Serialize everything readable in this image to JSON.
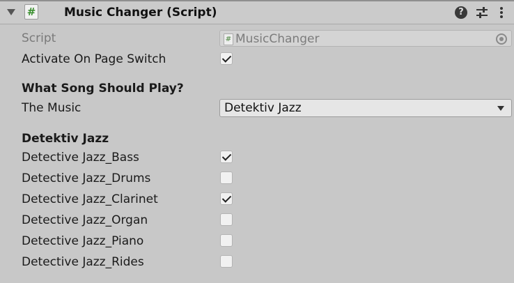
{
  "header": {
    "title": "Music Changer (Script)",
    "script_icon_glyph": "#",
    "help_glyph": "?"
  },
  "fields": {
    "script_label": "Script",
    "script_value": "MusicChanger",
    "activate_label": "Activate On Page Switch",
    "activate_checked": true,
    "section_song": "What Song Should Play?",
    "music_label": "The Music",
    "music_value": "Detektiv Jazz",
    "section_tracks": "Detektiv Jazz"
  },
  "tracks": [
    {
      "label": "Detective Jazz_Bass",
      "checked": true
    },
    {
      "label": "Detective Jazz_Drums",
      "checked": false
    },
    {
      "label": "Detective Jazz_Clarinet",
      "checked": true
    },
    {
      "label": "Detective Jazz_Organ",
      "checked": false
    },
    {
      "label": "Detective Jazz_Piano",
      "checked": false
    },
    {
      "label": "Detective Jazz_Rides",
      "checked": false
    }
  ],
  "colors": {
    "panel_bg": "#c8c8c8",
    "script_icon_green": "#3a8f2f"
  }
}
